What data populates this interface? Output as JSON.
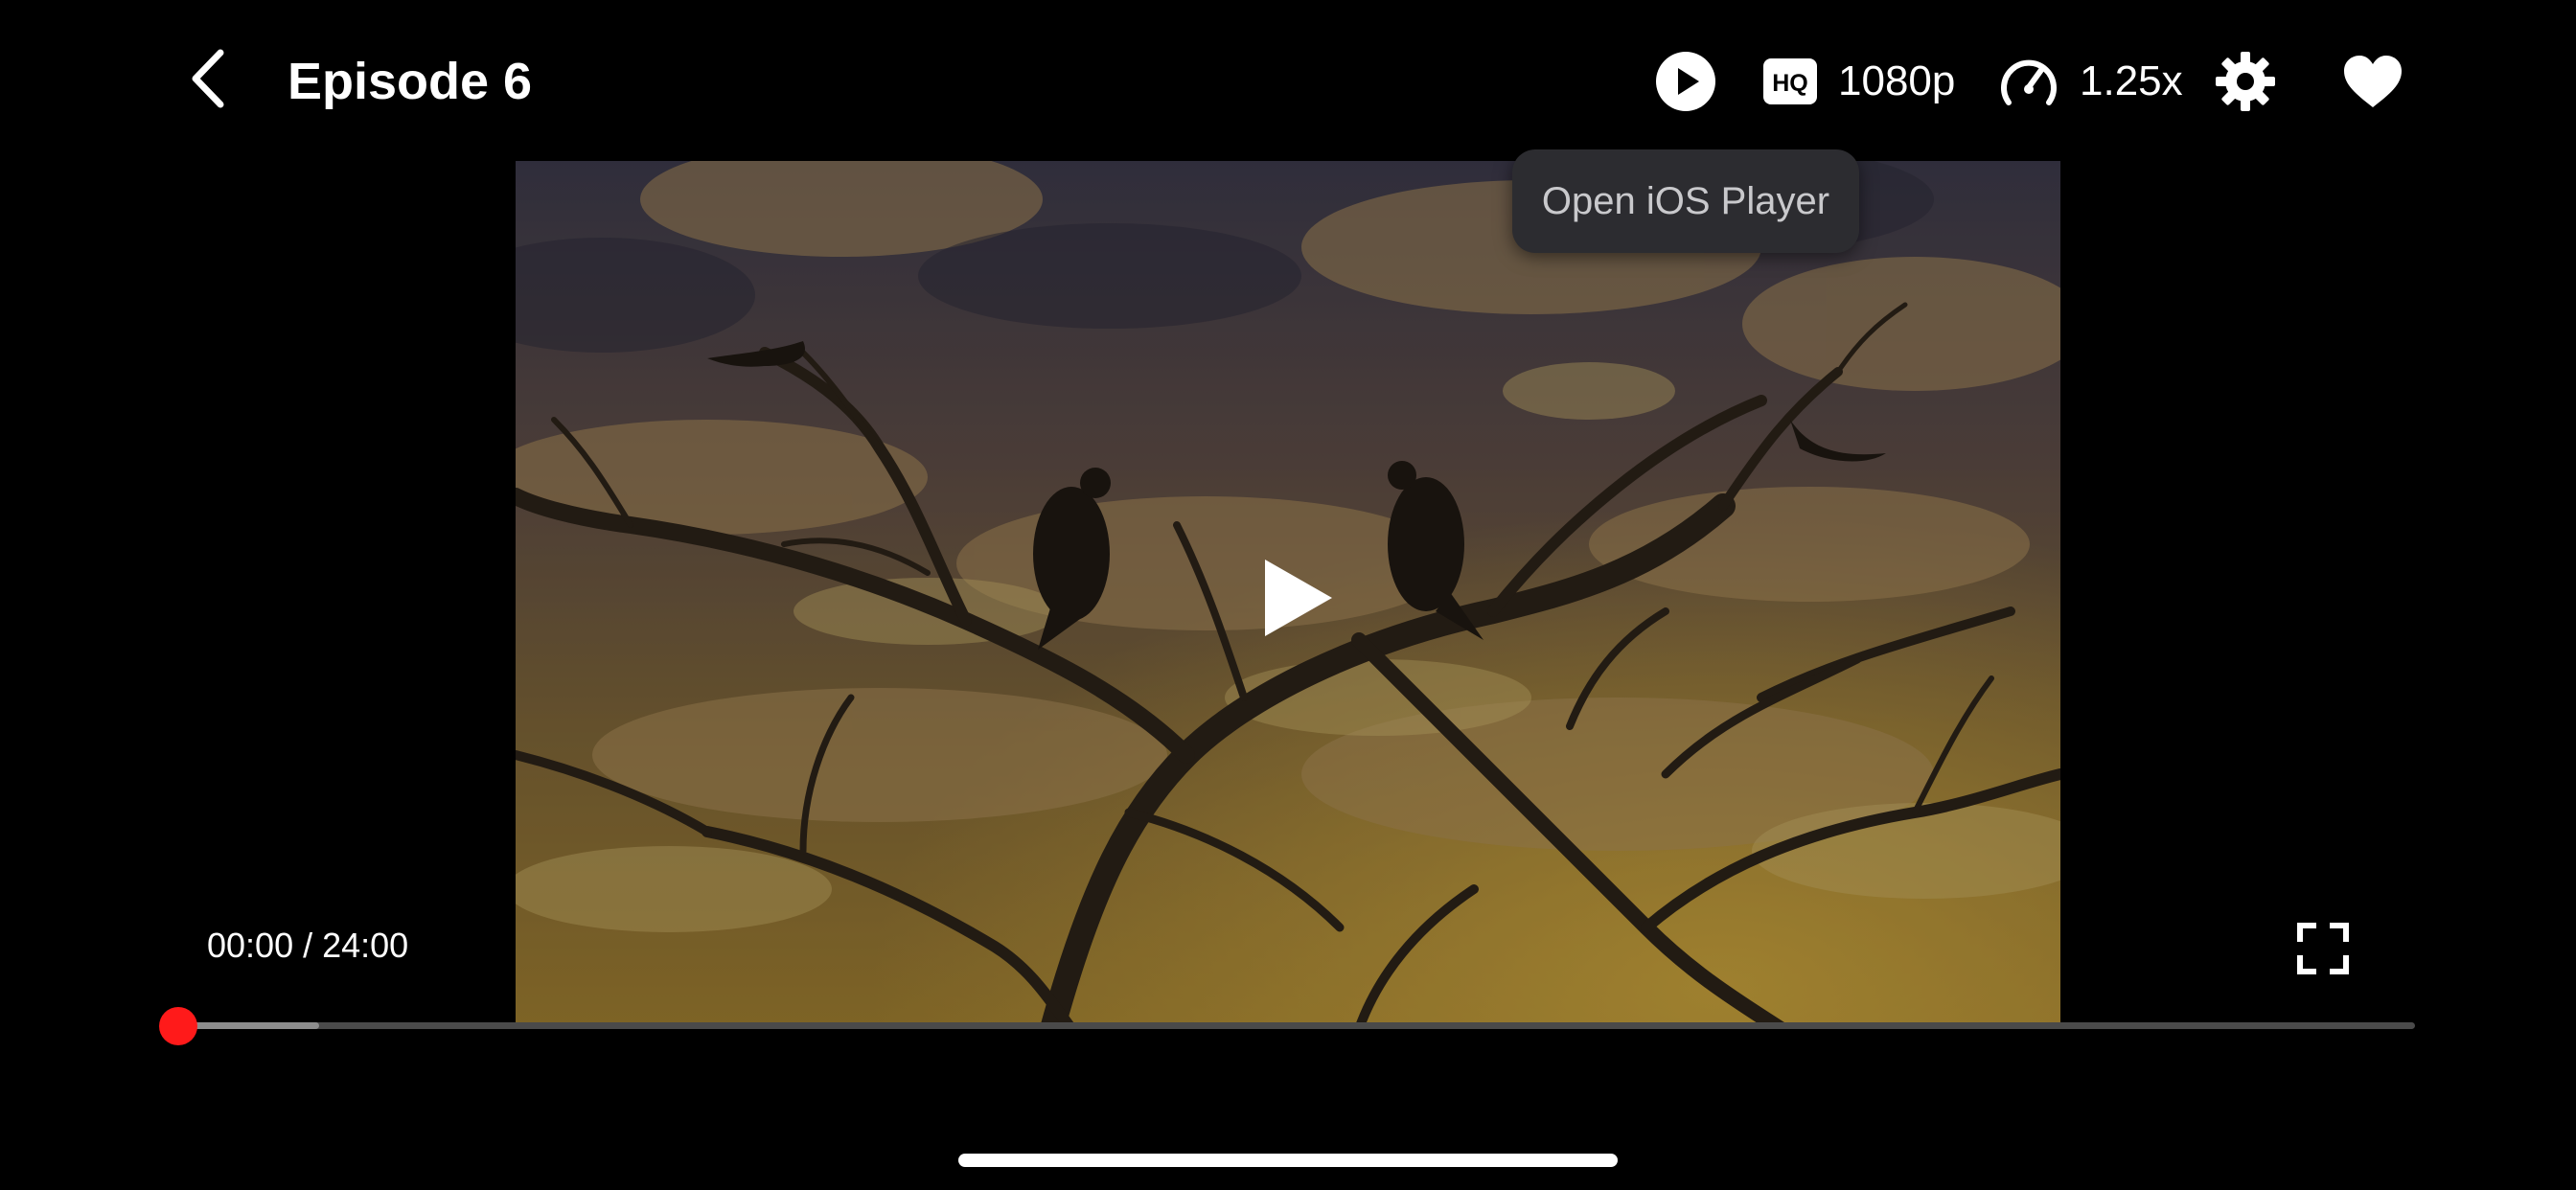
{
  "header": {
    "title": "Episode 6",
    "back_icon": "chevron-left-icon"
  },
  "controls": {
    "play_icon": "play-circle-icon",
    "quality_icon": "hq-badge-icon",
    "quality_label": "1080p",
    "speed_icon": "speedometer-icon",
    "speed_label": "1.25x",
    "settings_icon": "gear-icon",
    "favorite_icon": "heart-icon"
  },
  "tooltip": {
    "text": "Open iOS Player"
  },
  "player": {
    "time_readout": "00:00 / 24:00",
    "progress_fraction": 0.0,
    "buffered_fraction": 0.063,
    "center_icon": "play-icon",
    "fullscreen_icon": "fullscreen-icon"
  },
  "colors": {
    "background": "#000000",
    "accent": "#ff1a1a",
    "tooltip_bg": "#2c2c30",
    "tooltip_text": "#c9c9cc"
  }
}
